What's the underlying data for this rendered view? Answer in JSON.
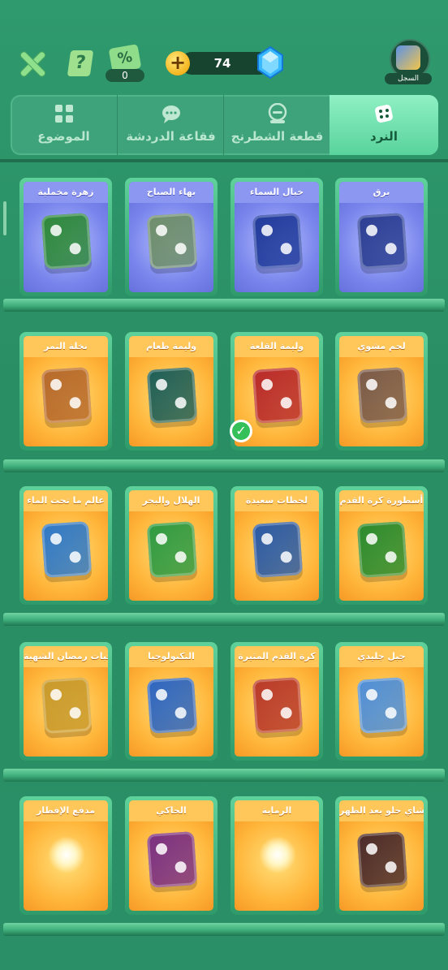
{
  "topbar": {
    "discount_count": "0",
    "coins": "74",
    "record_label": "السجل"
  },
  "tabs": [
    {
      "label": "الموضوع",
      "icon": "grid-icon"
    },
    {
      "label": "فقاعة الدردشة",
      "icon": "chat-bubble-icon"
    },
    {
      "label": "قطعة الشطرنج",
      "icon": "chess-piece-icon"
    },
    {
      "label": "النرد",
      "icon": "dice-icon"
    }
  ],
  "rows": [
    [
      {
        "title": "زهرة مخملية",
        "style": "blue",
        "dice_color": "#2f8a3a"
      },
      {
        "title": "بهاء الصباح",
        "style": "blue",
        "dice_color": "#6f8f6a"
      },
      {
        "title": "خيال السماء",
        "style": "blue",
        "dice_color": "#223c9c"
      },
      {
        "title": "برق",
        "style": "blue",
        "dice_color": "#2c3f93"
      }
    ],
    [
      {
        "title": "نخلة التمر",
        "style": "orange",
        "dice_color": "#b76a2c"
      },
      {
        "title": "وليمة طعام",
        "style": "orange",
        "dice_color": "#1e5f58"
      },
      {
        "title": "وليمة القلعة",
        "style": "orange",
        "dice_color": "#b92a2a"
      },
      {
        "title": "لحم مشوي",
        "style": "orange",
        "dice_color": "#7a5a4a"
      }
    ],
    [
      {
        "title": "عالم ما تحت الماء",
        "style": "orange",
        "dice_color": "#2f79c8"
      },
      {
        "title": "الهلال والبحر",
        "style": "orange",
        "dice_color": "#2e9b43"
      },
      {
        "title": "لحظات سعيدة",
        "style": "orange",
        "dice_color": "#2a5aa6"
      },
      {
        "title": "أسطورة كرة القدم",
        "style": "orange",
        "dice_color": "#2a8b2e"
      }
    ],
    [
      {
        "title": "وجبات رمضان الشهية",
        "style": "orange",
        "dice_color": "#c99a2c"
      },
      {
        "title": "التكنولوجيا",
        "style": "orange",
        "dice_color": "#2d66c2"
      },
      {
        "title": "كرة القدم المثيرة",
        "style": "orange",
        "dice_color": "#b93a2a"
      },
      {
        "title": "جبل جليدي",
        "style": "orange",
        "dice_color": "#4f8fd8"
      }
    ],
    [
      {
        "title": "مدفع الإفطار",
        "style": "orange",
        "dice_color": ""
      },
      {
        "title": "الحاكي",
        "style": "orange",
        "dice_color": "#7b2f82"
      },
      {
        "title": "الرماية",
        "style": "orange",
        "dice_color": ""
      },
      {
        "title": "شاي حلو بعد الظهر",
        "style": "orange",
        "dice_color": "#4b2a2a"
      }
    ]
  ],
  "selected_item": "وليمة القلعة"
}
